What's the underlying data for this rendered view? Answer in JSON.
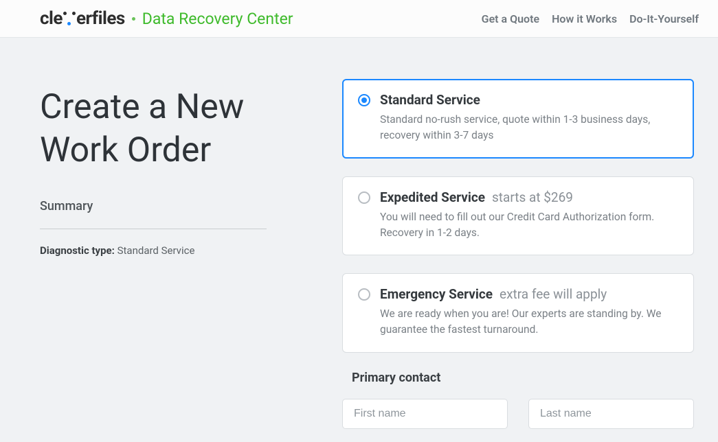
{
  "header": {
    "logo_text_left": "cle",
    "logo_text_right": "erfiles",
    "subtitle": "Data Recovery Center",
    "nav": {
      "quote": "Get a Quote",
      "how": "How it Works",
      "diy": "Do-It-Yourself"
    }
  },
  "left": {
    "title": "Create a New Work Order",
    "summary_heading": "Summary",
    "diag_label": "Diagnostic type:",
    "diag_value": "Standard Service"
  },
  "options": {
    "standard": {
      "title": "Standard Service",
      "price": "",
      "desc": "Standard no-rush service, quote within 1-3 business days, recovery within 3-7 days"
    },
    "expedited": {
      "title": "Expedited Service",
      "price": "starts at $269",
      "desc": "You will need to fill out our Credit Card Authorization form. Recovery in 1-2 days."
    },
    "emergency": {
      "title": "Emergency Service",
      "price": "extra fee will apply",
      "desc": "We are ready when you are! Our experts are standing by. We guarantee the fastest turnaround."
    }
  },
  "contact": {
    "heading": "Primary contact",
    "first_name_placeholder": "First name",
    "last_name_placeholder": "Last name",
    "first_name_value": "",
    "last_name_value": ""
  }
}
